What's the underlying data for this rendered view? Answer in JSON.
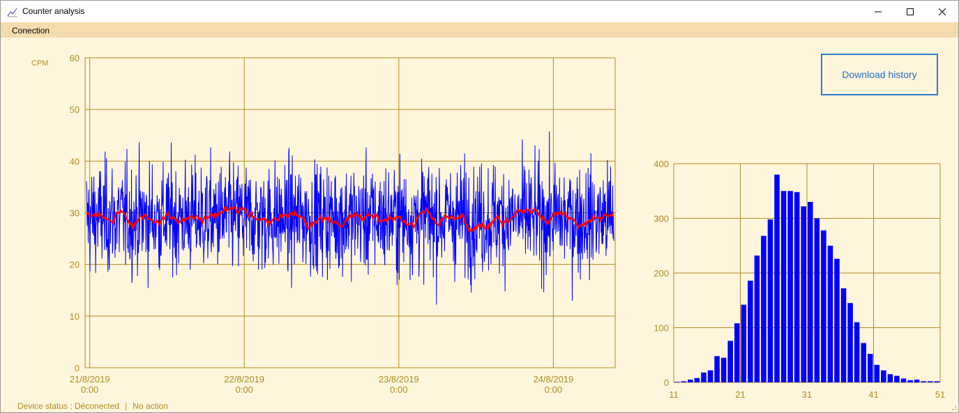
{
  "window": {
    "title": "Counter analysis",
    "controls": {
      "minimize": "minimize",
      "maximize": "maximize",
      "close": "close"
    }
  },
  "menu": {
    "items": [
      {
        "label": "Conection"
      }
    ]
  },
  "buttons": {
    "download_history": "Download history"
  },
  "status": {
    "device": "Device status : Déconected",
    "action": "No action"
  },
  "colors": {
    "background": "#fef6dc",
    "menubar": "#f5dcac",
    "axis_gold": "#b28b1c",
    "raw_series": "#0000ff",
    "avg_series": "#ff0000",
    "histogram_bar": "#0000ff",
    "button_border": "#2b7bd4"
  },
  "chart_data": [
    {
      "type": "line",
      "ylabel": "CPM",
      "ylim": [
        0,
        60
      ],
      "yticks": [
        0,
        10,
        20,
        30,
        40,
        50,
        60
      ],
      "xticks": [
        {
          "date": "21/8/2019",
          "time": "0:00"
        },
        {
          "date": "22/8/2019",
          "time": "0:00"
        },
        {
          "date": "23/8/2019",
          "time": "0:00"
        },
        {
          "date": "24/8/2019",
          "time": "0:00"
        }
      ],
      "xlim_days": [
        -0.03,
        3.4
      ],
      "grid": true,
      "series": [
        {
          "role": "raw",
          "color": "#0000ff",
          "baseline": 29,
          "range": [
            12,
            50
          ],
          "count": 1500
        },
        {
          "role": "moving-average",
          "color": "#ff0000",
          "range": [
            26.5,
            31
          ]
        }
      ]
    },
    {
      "type": "bar",
      "xlim": [
        11,
        51
      ],
      "xticks": [
        11,
        21,
        31,
        41,
        51
      ],
      "ylim": [
        0,
        400
      ],
      "yticks": [
        0,
        100,
        200,
        300,
        400
      ],
      "grid": true,
      "bins": [
        11,
        12,
        13,
        14,
        15,
        16,
        17,
        18,
        19,
        20,
        21,
        22,
        23,
        24,
        25,
        26,
        27,
        28,
        29,
        30,
        31,
        32,
        33,
        34,
        35,
        36,
        37,
        38,
        39,
        40,
        41,
        42,
        43,
        44,
        45,
        46,
        47,
        48,
        49,
        50
      ],
      "values": [
        1,
        2,
        5,
        8,
        18,
        22,
        48,
        45,
        76,
        108,
        142,
        186,
        232,
        268,
        298,
        380,
        350,
        350,
        348,
        322,
        330,
        300,
        278,
        250,
        226,
        172,
        145,
        110,
        72,
        52,
        32,
        22,
        15,
        12,
        7,
        4,
        5,
        2,
        2,
        2
      ]
    }
  ]
}
